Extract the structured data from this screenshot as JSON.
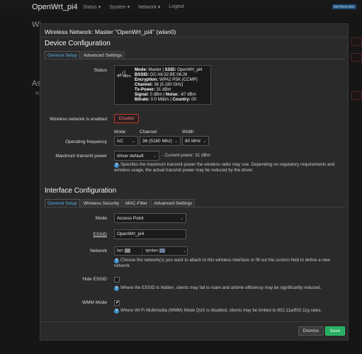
{
  "app": {
    "title": "OpenWrt_pi4"
  },
  "topnav": {
    "status": "Status",
    "system": "System",
    "network": "Network",
    "logout": "Logout",
    "chevron": "▾"
  },
  "refresh_badge": "REFRESHING",
  "background": {
    "heading_1": "Wi",
    "heading_2": "As",
    "side_text": "N"
  },
  "modal": {
    "title": "Wireless Network: Master \"OpenWrt_pi4\" (wlan0)",
    "device_section": {
      "title": "Device Configuration",
      "tabs": [
        "General Setup",
        "Advanced Settings"
      ],
      "status_label": "Status",
      "signal_value": "-87 dBm",
      "status_lines": [
        {
          "k": "Mode:",
          "v": " Master | ",
          "k2": "SSID:",
          "v2": " OpenWrt_pi4"
        },
        {
          "k": "BSSID:",
          "v": " DC:A6:32:BE:06:26"
        },
        {
          "k": "Encryption:",
          "v": " WPA2 PSK (CCMP)"
        },
        {
          "k": "Channel:",
          "v": " 36 (5.180 GHz)"
        },
        {
          "k": "Tx-Power:",
          "v": " 31 dBm"
        },
        {
          "k": "Signal:",
          "v": " 0 dBm | ",
          "k2": "Noise:",
          "v2": " -87 dBm"
        },
        {
          "k": "Bitrate:",
          "v": " 0.0 Mbit/s | ",
          "k2": "Country:",
          "v2": " 00"
        }
      ],
      "enabled_label": "Wireless network is enabled",
      "disable_button": "Disable",
      "freq_label": "Operating frequency",
      "freq_columns": {
        "mode": "Mode",
        "channel": "Channel",
        "width": "Width"
      },
      "freq_values": {
        "mode": "AC",
        "channel": "36 (5180 Mhz)",
        "width": "80 MHz"
      },
      "txpower_label": "Maximum transmit power",
      "txpower_value": "driver default",
      "txpower_current": "- Current power: 31 dBm",
      "txpower_help": "Specifies the maximum transmit power the wireless radio may use. Depending on regulatory requirements and wireless usage, the actual transmit power may be reduced by the driver."
    },
    "interface_section": {
      "title": "Interface Configuration",
      "tabs": [
        "General Setup",
        "Wireless Security",
        "MAC-Filter",
        "Advanced Settings"
      ],
      "mode_label": "Mode",
      "mode_value": "Access Point",
      "essid_label": "ESSID",
      "essid_value": "OpenWrt_pi4",
      "network_label": "Network",
      "network_chips": [
        "lan:",
        "vpnlan:"
      ],
      "network_help_1": "Choose the network(s) you want to attach to this wireless interface or fill out the ",
      "network_help_custom": "custom",
      "network_help_2": " field to define a new network.",
      "hide_essid_label": "Hide ESSID",
      "hide_essid_checked": false,
      "hide_essid_help": "Where the ESSID is hidden, clients may fail to roam and airtime efficiency may be significantly reduced.",
      "wmm_label": "WMM Mode",
      "wmm_checked": true,
      "wmm_help": "Where Wi-Fi Multimedia (WMM) Mode QoS is disabled, clients may be limited to 802.11a/802.11g rates."
    },
    "footer": {
      "dismiss": "Dismiss",
      "save": "Save"
    }
  },
  "colors": {
    "accent": "#5cb3e6",
    "danger": "#c0392b",
    "save": "#27ae60",
    "help_icon": "#3d8fc7"
  },
  "icons": {
    "help": "info-circle-icon",
    "chevron": "chevron-down-icon",
    "signal": "signal-icon",
    "check": "check-icon"
  }
}
